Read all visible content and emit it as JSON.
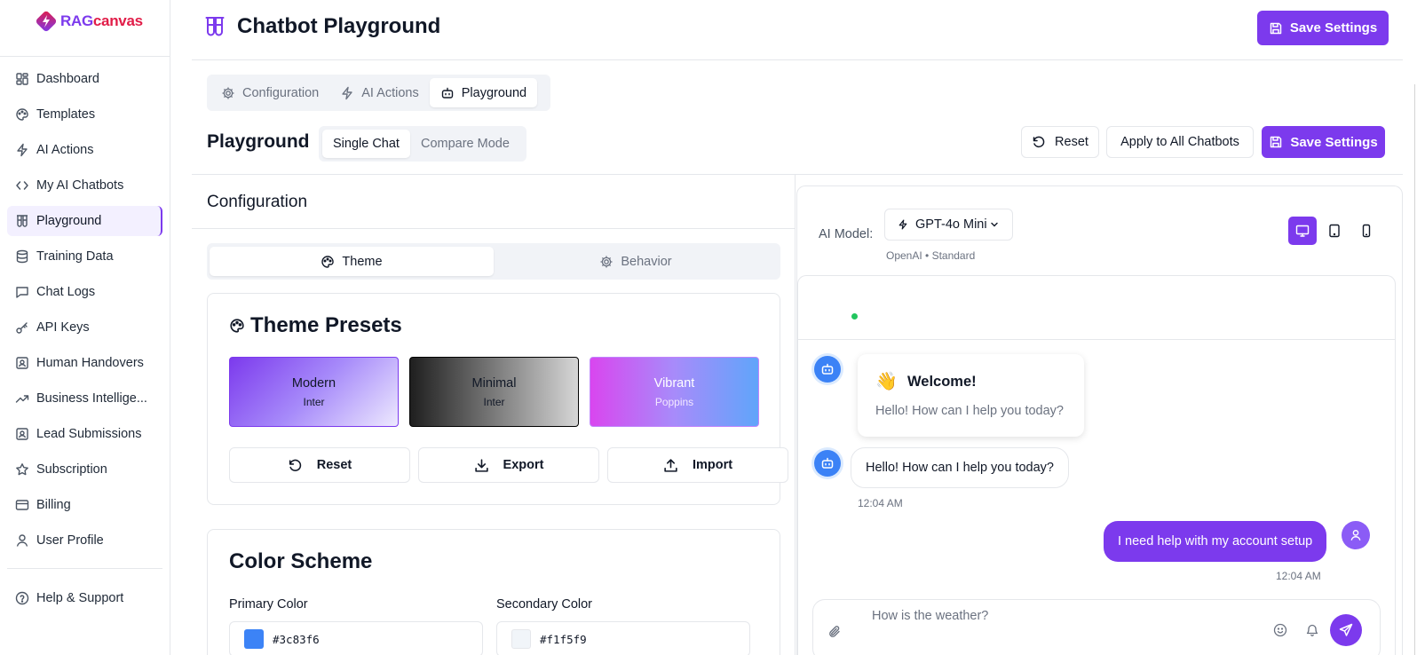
{
  "brand": {
    "name_part1": "RAG",
    "name_part2": "canvas",
    "accent": "#7c3aed",
    "accent2": "#e11d48"
  },
  "sidebar": {
    "items": [
      {
        "label": "Dashboard",
        "icon": "grid-icon"
      },
      {
        "label": "Templates",
        "icon": "palette-icon"
      },
      {
        "label": "AI Actions",
        "icon": "bolt-icon"
      },
      {
        "label": "My AI Chatbots",
        "icon": "code-icon"
      },
      {
        "label": "Playground",
        "icon": "test-tubes-icon",
        "active": true
      },
      {
        "label": "Training Data",
        "icon": "database-icon"
      },
      {
        "label": "Chat Logs",
        "icon": "chat-icon"
      },
      {
        "label": "API Keys",
        "icon": "key-icon"
      },
      {
        "label": "Human Handovers",
        "icon": "contact-icon"
      },
      {
        "label": "Business Intellige...",
        "icon": "trending-icon"
      },
      {
        "label": "Lead Submissions",
        "icon": "contact-icon"
      },
      {
        "label": "Subscription",
        "icon": "star-icon"
      },
      {
        "label": "Billing",
        "icon": "card-icon"
      },
      {
        "label": "User Profile",
        "icon": "user-icon"
      }
    ],
    "help": "Help & Support"
  },
  "header": {
    "title": "Chatbot Playground",
    "save_label": "Save Settings"
  },
  "tabs": [
    {
      "label": "Configuration",
      "icon": "gear-icon"
    },
    {
      "label": "AI Actions",
      "icon": "bolt-icon"
    },
    {
      "label": "Playground",
      "icon": "bot-icon",
      "active": true
    }
  ],
  "playground": {
    "title": "Playground",
    "modes": [
      "Single Chat",
      "Compare Mode"
    ],
    "active_mode": "Single Chat",
    "reset_label": "Reset",
    "apply_label": "Apply to All Chatbots",
    "save_label": "Save Settings"
  },
  "config": {
    "title": "Configuration",
    "segments": [
      {
        "label": "Theme",
        "icon": "palette-icon",
        "active": true
      },
      {
        "label": "Behavior",
        "icon": "gear-icon"
      }
    ],
    "presets_title": "Theme Presets",
    "presets": [
      {
        "name": "Modern",
        "font": "Inter"
      },
      {
        "name": "Minimal",
        "font": "Inter"
      },
      {
        "name": "Vibrant",
        "font": "Poppins"
      }
    ],
    "preset_actions": {
      "reset": "Reset",
      "export": "Export",
      "import": "Import"
    },
    "color_scheme_title": "Color Scheme",
    "primary_label": "Primary Color",
    "primary_value": "#3c83f6",
    "secondary_label": "Secondary Color",
    "secondary_value": "#f1f5f9"
  },
  "preview": {
    "model_label": "AI Model:",
    "model_value": "GPT-4o Mini",
    "model_sub": "OpenAI • Standard",
    "devices": [
      {
        "name": "desktop-icon",
        "active": true
      },
      {
        "name": "tablet-icon"
      },
      {
        "name": "mobile-icon"
      }
    ],
    "welcome_emoji": "👋",
    "welcome_title": "Welcome!",
    "welcome_sub": "Hello! How can I help you today?",
    "bot_message": "Hello! How can I help you today?",
    "bot_time": "12:04 AM",
    "user_message": "I need help with my account setup",
    "user_time": "12:04 AM",
    "input_placeholder": "How is the weather?"
  }
}
